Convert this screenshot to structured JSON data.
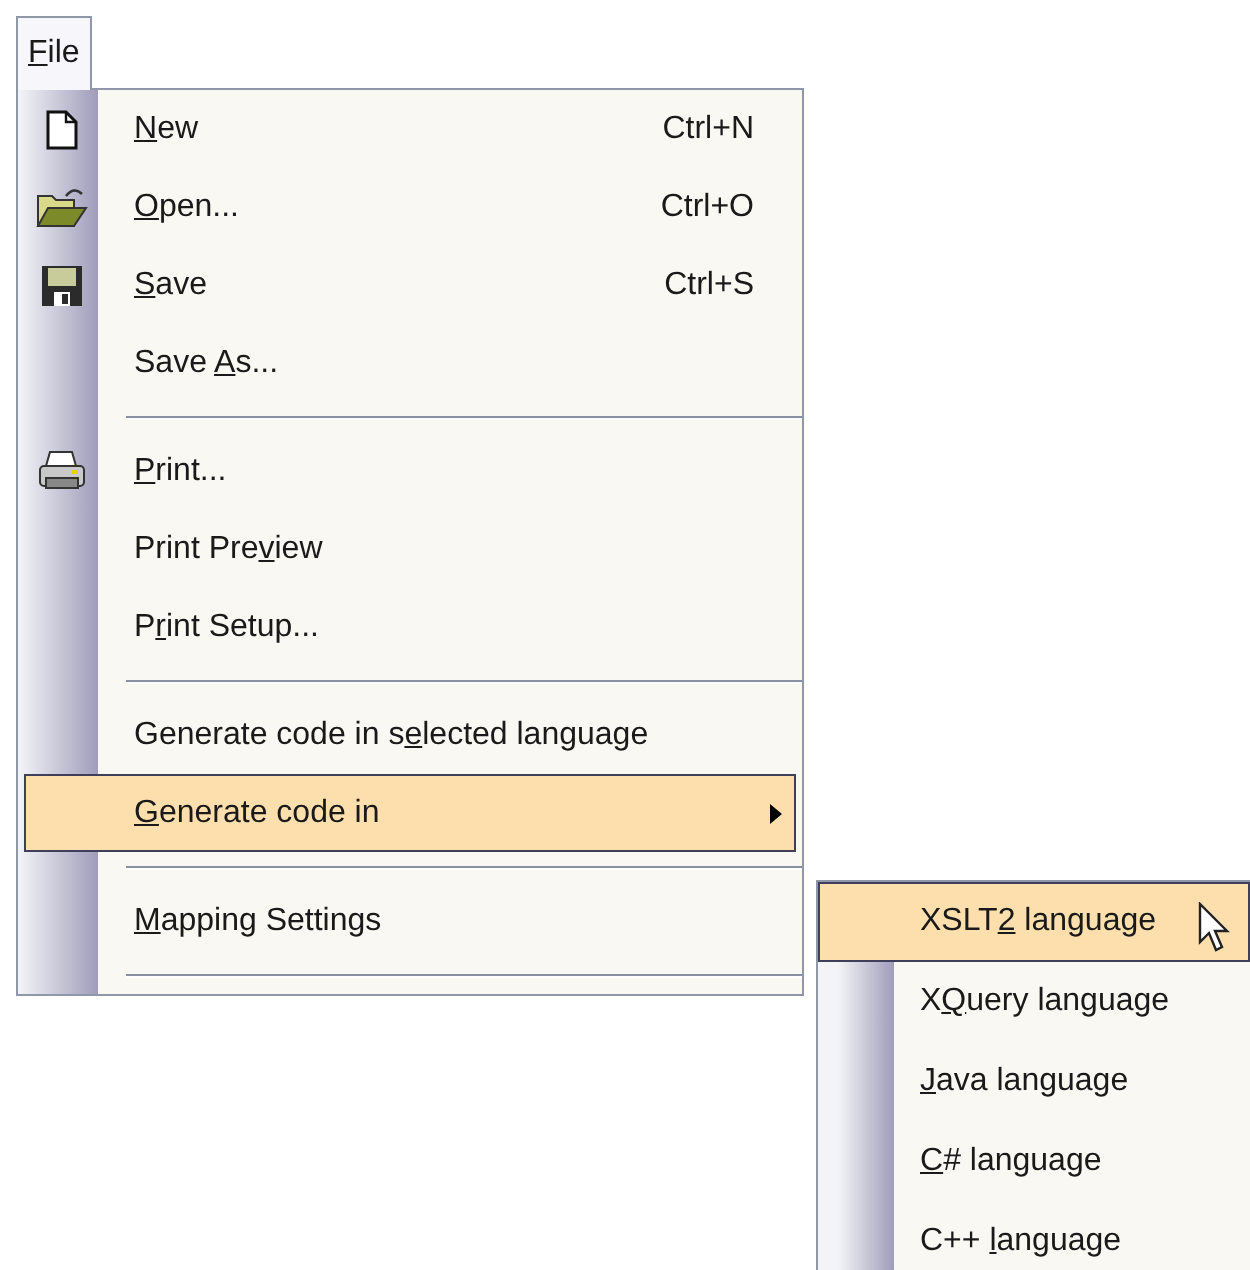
{
  "menu_bar": [
    {
      "label": {
        "key": "F",
        "after": "ile"
      },
      "selected": true
    }
  ],
  "file_menu": [
    {
      "kind": "item",
      "label": {
        "key": "N",
        "after": "ew"
      },
      "shortcut": "Ctrl+N",
      "selected": false
    },
    {
      "kind": "item",
      "label": {
        "key": "O",
        "after": "pen..."
      },
      "shortcut": "Ctrl+O",
      "selected": false
    },
    {
      "kind": "item",
      "label": {
        "key": "S",
        "after": "ave"
      },
      "shortcut": "Ctrl+S",
      "selected": false
    },
    {
      "kind": "item",
      "label": {
        "before": "Save ",
        "key": "A",
        "after": "s..."
      },
      "selected": false
    },
    {
      "kind": "separator"
    },
    {
      "kind": "item",
      "label": {
        "key": "P",
        "after": "rint..."
      },
      "selected": false
    },
    {
      "kind": "item",
      "label": {
        "before": "Print Pre",
        "key": "v",
        "after": "iew"
      },
      "selected": false
    },
    {
      "kind": "item",
      "label": {
        "before": "P",
        "key": "r",
        "after": "int Setup..."
      },
      "selected": false
    },
    {
      "kind": "separator"
    },
    {
      "kind": "item",
      "label": {
        "before": "Generate code in s",
        "key": "e",
        "after": "lected language"
      },
      "selected": false
    },
    {
      "kind": "item",
      "label": {
        "key": "G",
        "after": "enerate code in"
      },
      "has_submenu": true,
      "selected": true
    },
    {
      "kind": "separator"
    },
    {
      "kind": "item",
      "label": {
        "key": "M",
        "after": "apping Settings"
      },
      "selected": false
    },
    {
      "kind": "separator"
    }
  ],
  "submenu": [
    {
      "label": {
        "before": "XSLT",
        "key": "2",
        "after": " language"
      },
      "selected": true
    },
    {
      "label": {
        "before": "X",
        "key": "Q",
        "after": "uery language"
      },
      "selected": false
    },
    {
      "label": {
        "key": "J",
        "after": "ava language"
      },
      "selected": false
    },
    {
      "label": {
        "key": "C",
        "after": "# language"
      },
      "selected": false
    },
    {
      "label": {
        "before": "C++ ",
        "key": "l",
        "after": "anguage"
      },
      "selected": false
    }
  ]
}
